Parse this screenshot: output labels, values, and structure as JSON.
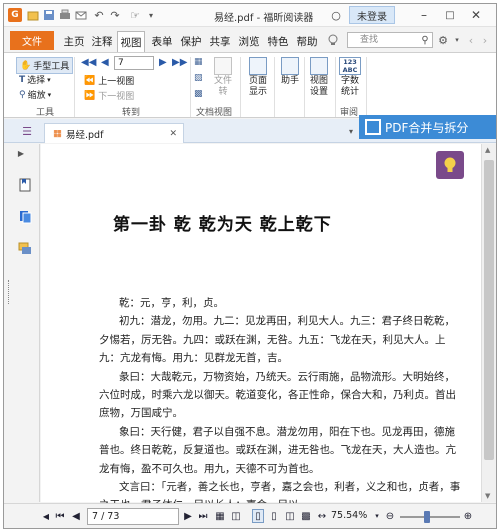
{
  "titlebar": {
    "title": "易经.pdf - 福昕阅读器",
    "login_label": "未登录",
    "icons": [
      "app-logo-icon",
      "open-icon",
      "save-icon",
      "print-icon",
      "mail-icon",
      "undo-icon",
      "redo-icon",
      "select-tool-icon",
      "customize-icon",
      "settings-icon",
      "minimize-icon",
      "maximize-icon",
      "close-icon"
    ]
  },
  "menubar": {
    "file_label": "文件",
    "items": [
      "主页",
      "注释",
      "视图",
      "表单",
      "保护",
      "共享",
      "浏览",
      "特色",
      "帮助"
    ],
    "active": "视图",
    "search_placeholder": "查找"
  },
  "ribbon": {
    "tools": {
      "hand": "手型工具",
      "select": "选择",
      "zoom": "缩放",
      "label": "工具"
    },
    "goto": {
      "page_value": "7",
      "prev_view": "上一视图",
      "next_view": "下一视图",
      "label": "转到"
    },
    "docview": {
      "reflow": "文件 转",
      "label": "文档视图"
    },
    "page_display": "页面 显示",
    "assistant": "助手",
    "view_settings": "视图 设置",
    "wordcount_glyph": "123 ABC",
    "wordcount": "字数 统计",
    "review_label": "审阅"
  },
  "tabs": {
    "doc_name": "易经.pdf",
    "banner": "PDF合并与拆分"
  },
  "document": {
    "heading": "第一卦 乾 乾为天 乾上乾下",
    "paragraphs": [
      "乾：元，亨，利，贞。",
      "初九：潜龙，勿用。九二：见龙再田，利见大人。九三：君子终日乾乾，夕惕若，厉无咎。九四：或跃在渊，无咎。九五：飞龙在天，利见大人。上九：亢龙有悔。用九：见群龙无首，吉。",
      "彖曰：大哉乾元，万物资始，乃统天。云行雨施，品物流形。大明始终，六位时成，时乘六龙以御天。乾道变化，各正性命，保合大和，乃利贞。首出庶物，万国咸宁。",
      "象曰：天行健，君子以自强不息。潜龙勿用，阳在下也。见龙再田，德施普也。终日乾乾，反复道也。或跃在渊，进无咎也。飞龙在天，大人造也。亢龙有悔，盈不可久也。用九，天德不可为首也。",
      "文言曰：「元者，善之长也，亨者，嘉之会也，利者，义之和也，贞者，事之干也。君子体仁，足以长人；嘉会，足以"
    ]
  },
  "statusbar": {
    "page_field": "7 / 73",
    "zoom": "75.54%"
  },
  "colors": {
    "accent_orange": "#e8711c",
    "banner_blue": "#3c8bd6",
    "bulb_purple": "#7a4a8a"
  }
}
